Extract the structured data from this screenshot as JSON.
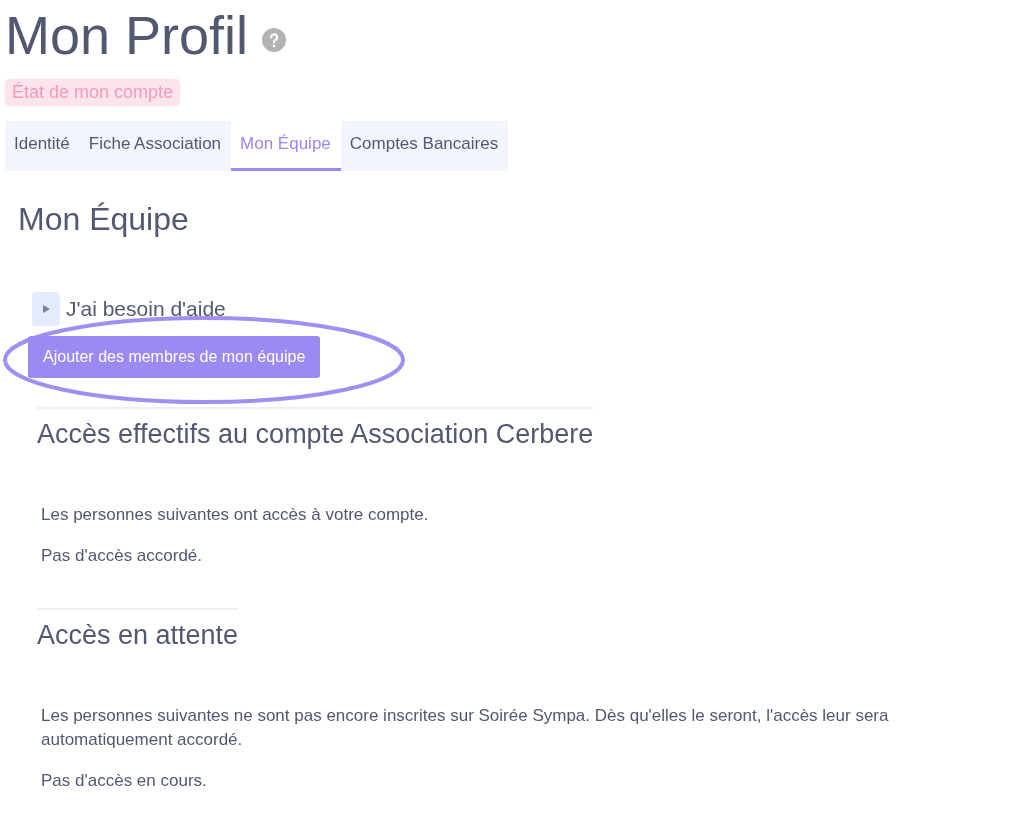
{
  "page": {
    "title": "Mon Profil",
    "status_badge": "État de mon compte"
  },
  "tabs": [
    {
      "label": "Identité",
      "selected": false
    },
    {
      "label": "Fiche Association",
      "selected": false
    },
    {
      "label": "Mon Équipe",
      "selected": true
    },
    {
      "label": "Comptes Bancaires",
      "selected": false
    }
  ],
  "section": {
    "title": "Mon Équipe",
    "help": {
      "label": "J'ai besoin d'aide",
      "expanded": false
    },
    "add_button": "Ajouter des membres de mon équipe"
  },
  "groups": [
    {
      "title": "Accès effectifs au compte Association Cerbere",
      "description": "Les personnes suivantes ont accès à votre compte.",
      "empty": "Pas d'accès accordé."
    },
    {
      "title": "Accès en attente",
      "description": "Les personnes suivantes ne sont pas encore inscrites sur Soirée Sympa. Dès qu'elles le seront, l'accès leur sera automatiquement accordé.",
      "empty": "Pas d'accès en cours."
    }
  ]
}
